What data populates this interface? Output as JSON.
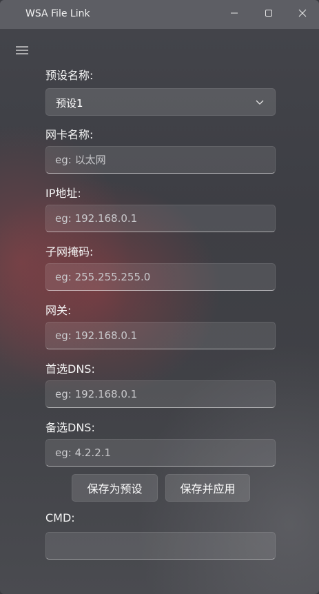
{
  "window": {
    "title": "WSA File Link"
  },
  "form": {
    "preset": {
      "label": "预设名称:",
      "value": "预设1"
    },
    "adapter": {
      "label": "网卡名称:",
      "placeholder": "eg: 以太网"
    },
    "ip": {
      "label": "IP地址:",
      "placeholder": "eg: 192.168.0.1"
    },
    "subnet": {
      "label": "子网掩码:",
      "placeholder": "eg: 255.255.255.0"
    },
    "gateway": {
      "label": "网关:",
      "placeholder": "eg: 192.168.0.1"
    },
    "dns_primary": {
      "label": "首选DNS:",
      "placeholder": "eg: 192.168.0.1"
    },
    "dns_alternate": {
      "label": "备选DNS:",
      "placeholder": "eg: 4.2.2.1"
    },
    "buttons": {
      "save_preset": "保存为预设",
      "save_apply": "保存并应用"
    },
    "cmd": {
      "label": "CMD:",
      "value": ""
    }
  },
  "icons": {
    "menu": "hamburger-menu-icon",
    "minimize": "minimize-icon",
    "maximize": "maximize-icon",
    "close": "close-icon",
    "dropdown": "chevron-down-icon"
  }
}
